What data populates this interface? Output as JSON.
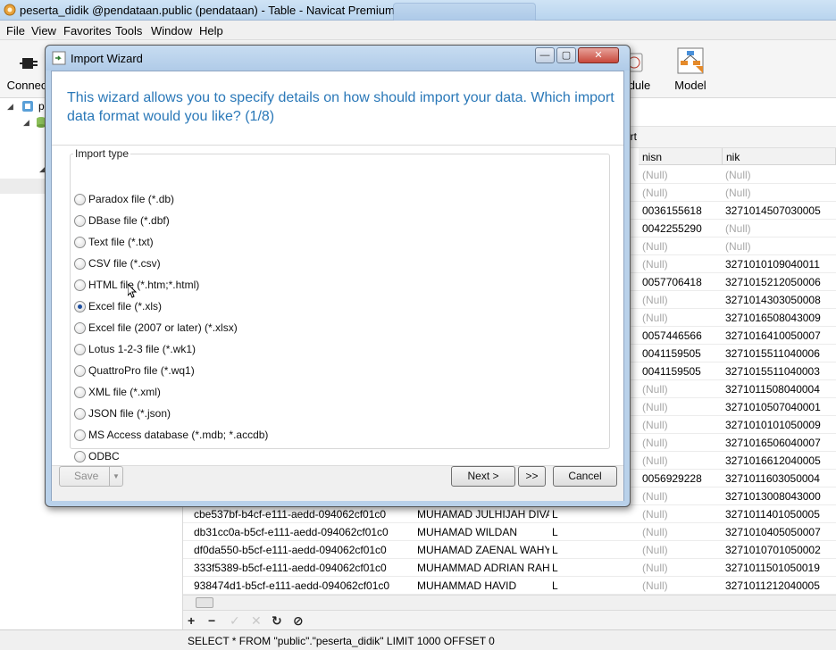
{
  "window": {
    "title": "peserta_didik @pendataan.public (pendataan) - Table - Navicat Premium"
  },
  "menu": [
    "File",
    "View",
    "Favorites",
    "Tools",
    "Window",
    "Help"
  ],
  "toolbar": {
    "left_label": "Connec",
    "items": [
      "dule",
      "Model"
    ]
  },
  "tree": {
    "node_label": "p"
  },
  "object_toolbar": {
    "label": "ort"
  },
  "grid": {
    "columns": [
      "nisn",
      "nik"
    ],
    "rows": [
      {
        "id": "",
        "name": "",
        "jk": "",
        "nisn": "(Null)",
        "nik": "(Null)"
      },
      {
        "id": "",
        "name": "",
        "jk": "",
        "nisn": "(Null)",
        "nik": "(Null)"
      },
      {
        "id": "",
        "name": "",
        "jk": "",
        "nisn": "0036155618",
        "nik": "3271014507030005"
      },
      {
        "id": "",
        "name": "",
        "jk": "",
        "nisn": "0042255290",
        "nik": "(Null)"
      },
      {
        "id": "",
        "name": "",
        "jk": "",
        "nisn": "(Null)",
        "nik": "(Null)"
      },
      {
        "id": "",
        "name": "",
        "jk": "",
        "nisn": "(Null)",
        "nik": "3271010109040011"
      },
      {
        "id": "",
        "name": "",
        "jk": "",
        "nisn": "0057706418",
        "nik": "3271015212050006"
      },
      {
        "id": "",
        "name": "",
        "jk": "",
        "nisn": "(Null)",
        "nik": "3271014303050008"
      },
      {
        "id": "",
        "name": "",
        "jk": "",
        "nisn": "(Null)",
        "nik": "3271016508043009"
      },
      {
        "id": "",
        "name": "",
        "jk": "",
        "nisn": "0057446566",
        "nik": "3271016410050007"
      },
      {
        "id": "",
        "name": "",
        "jk": "",
        "nisn": "0041159505",
        "nik": "3271015511040006"
      },
      {
        "id": "",
        "name": "",
        "jk": "",
        "nisn": "0041159505",
        "nik": "3271015511040003"
      },
      {
        "id": "",
        "name": "",
        "jk": "",
        "nisn": "(Null)",
        "nik": "3271011508040004"
      },
      {
        "id": "",
        "name": "",
        "jk": "",
        "nisn": "(Null)",
        "nik": "3271010507040001"
      },
      {
        "id": "",
        "name": "",
        "jk": "",
        "nisn": "(Null)",
        "nik": "3271010101050009"
      },
      {
        "id": "",
        "name": "",
        "jk": "",
        "nisn": "(Null)",
        "nik": "3271016506040007"
      },
      {
        "id": "",
        "name": "",
        "jk": "",
        "nisn": "(Null)",
        "nik": "3271016612040005"
      },
      {
        "id": "",
        "name": "",
        "jk": "",
        "nisn": "0056929228",
        "nik": "3271011603050004"
      },
      {
        "id": "",
        "name": "",
        "jk": "",
        "nisn": "(Null)",
        "nik": "3271013008043000"
      },
      {
        "id": "cbe537bf-b4cf-e111-aedd-094062cf01c0",
        "name": "MUHAMAD JULHIJAH DIVAI",
        "jk": "L",
        "nisn": "(Null)",
        "nik": "3271011401050005"
      },
      {
        "id": "db31cc0a-b5cf-e111-aedd-094062cf01c0",
        "name": "MUHAMAD WILDAN",
        "jk": "L",
        "nisn": "(Null)",
        "nik": "3271010405050007"
      },
      {
        "id": "df0da550-b5cf-e111-aedd-094062cf01c0",
        "name": "MUHAMAD ZAENAL WAHY",
        "jk": "L",
        "nisn": "(Null)",
        "nik": "3271010701050002"
      },
      {
        "id": "333f5389-b5cf-e111-aedd-094062cf01c0",
        "name": "MUHAMMAD ADRIAN RAH",
        "jk": "L",
        "nisn": "(Null)",
        "nik": "3271011501050019"
      },
      {
        "id": "938474d1-b5cf-e111-aedd-094062cf01c0",
        "name": "MUHAMMAD HAVID",
        "jk": "L",
        "nisn": "(Null)",
        "nik": "3271011212040005"
      }
    ]
  },
  "gridtools": [
    "+",
    "−",
    "✓",
    "✕",
    "↻",
    "⊘"
  ],
  "status": {
    "sql": "SELECT * FROM \"public\".\"peserta_didik\" LIMIT 1000 OFFSET 0"
  },
  "dialog": {
    "title": "Import Wizard",
    "header": "This wizard allows you to specify details on how should import your data. Which import data format would you like? (1/8)",
    "group_label": "Import type",
    "options": [
      {
        "label": "Paradox file (*.db)",
        "checked": false
      },
      {
        "label": "DBase file (*.dbf)",
        "checked": false
      },
      {
        "label": "Text file (*.txt)",
        "checked": false
      },
      {
        "label": "CSV file (*.csv)",
        "checked": false
      },
      {
        "label": "HTML file (*.htm;*.html)",
        "checked": false
      },
      {
        "label": "Excel file (*.xls)",
        "checked": true
      },
      {
        "label": "Excel file (2007 or later) (*.xlsx)",
        "checked": false
      },
      {
        "label": "Lotus 1-2-3 file (*.wk1)",
        "checked": false
      },
      {
        "label": "QuattroPro file (*.wq1)",
        "checked": false
      },
      {
        "label": "XML file (*.xml)",
        "checked": false
      },
      {
        "label": "JSON file (*.json)",
        "checked": false
      },
      {
        "label": "MS Access database (*.mdb; *.accdb)",
        "checked": false
      },
      {
        "label": "ODBC",
        "checked": false
      }
    ],
    "buttons": {
      "save": "Save",
      "next": "Next >",
      "last": ">>",
      "cancel": "Cancel"
    },
    "winbuttons": {
      "min": "—",
      "max": "▢",
      "close": "✕"
    }
  }
}
